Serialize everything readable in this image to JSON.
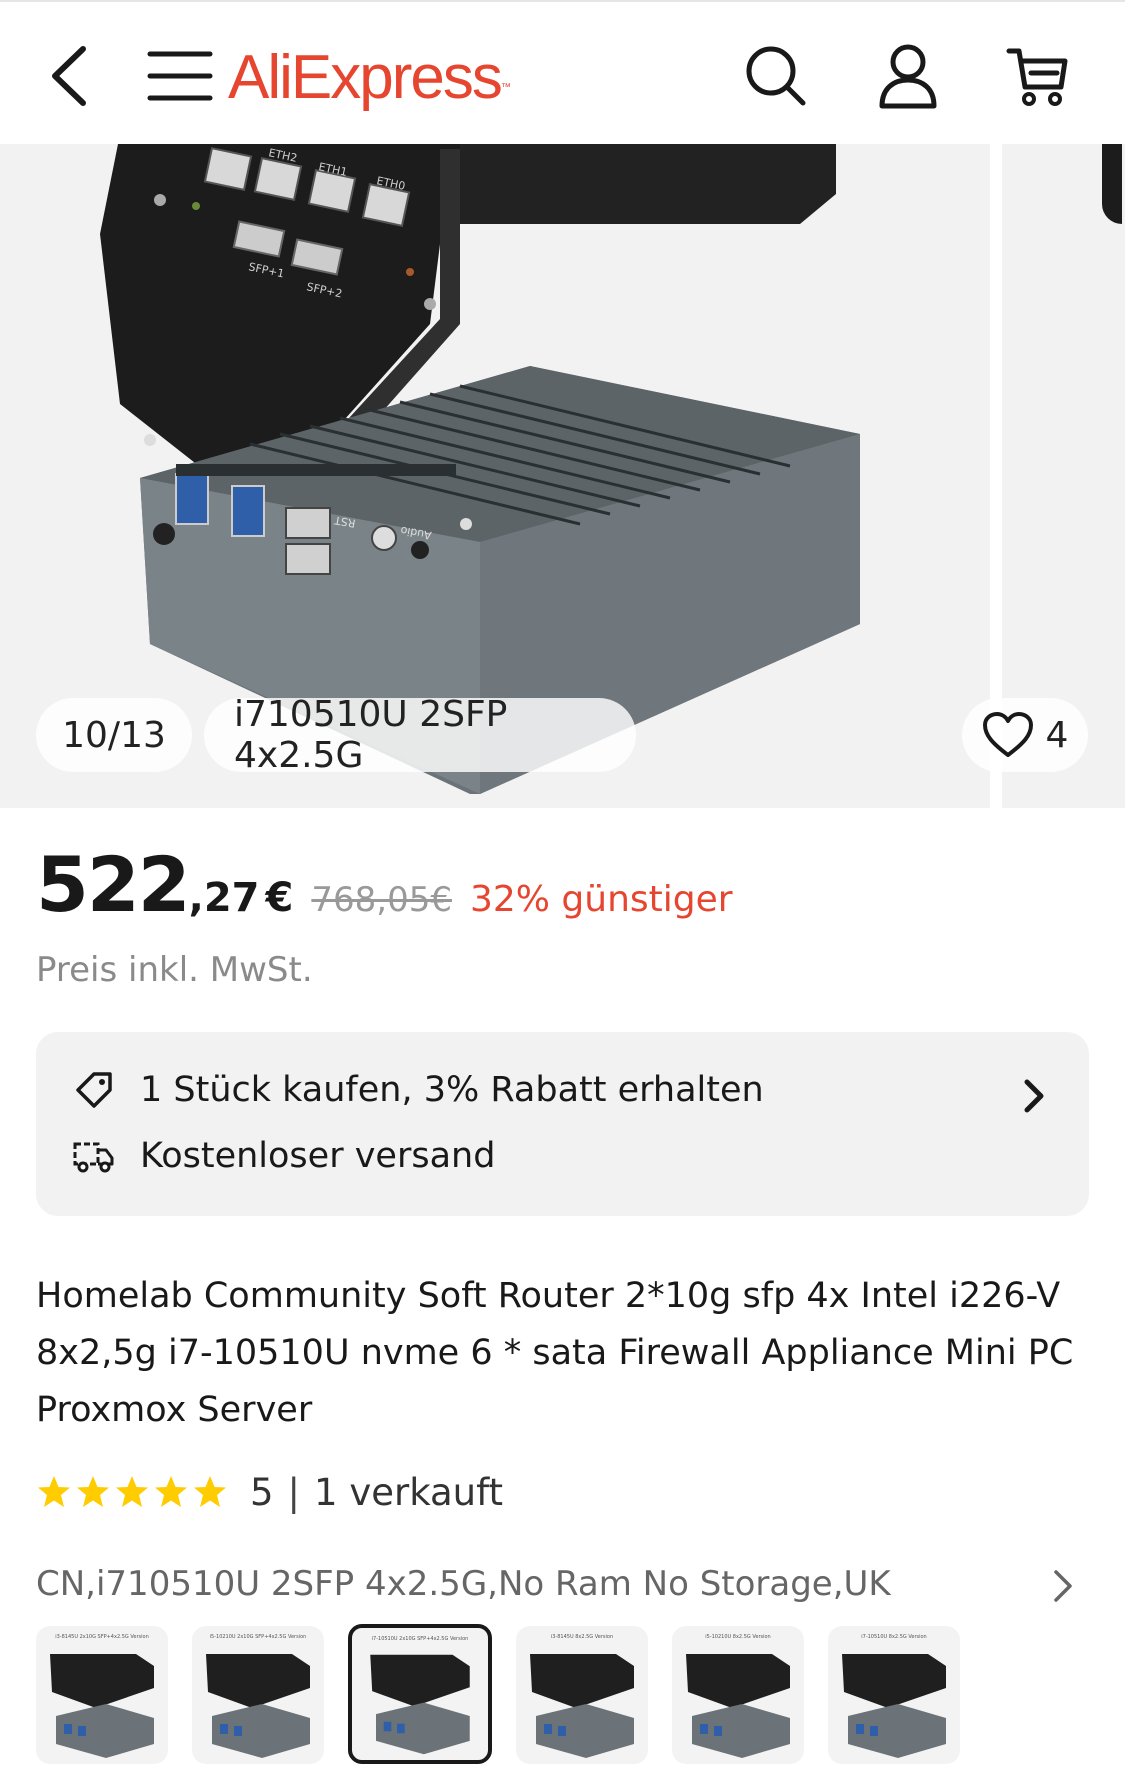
{
  "header": {
    "logo_text": "AliExpress",
    "logo_tm": "™",
    "brand_color": "#e6452f",
    "icons": [
      "back-icon",
      "menu-icon",
      "search-icon",
      "account-icon",
      "cart-icon"
    ]
  },
  "gallery": {
    "counter": "10/13",
    "variant_label": "i710510U 2SFP 4x2.5G",
    "wishlist_count": "4",
    "port_labels": [
      "ETH2",
      "ETH1",
      "ETH0",
      "SFP+1",
      "SFP+2",
      "RST",
      "Audio"
    ]
  },
  "price": {
    "integer": "522",
    "decimal": ",27",
    "currency": "€",
    "original": "768,05€",
    "discount": "32% günstiger",
    "vat_note": "Preis inkl. MwSt."
  },
  "promo": {
    "discount_text": "1 Stück kaufen, 3% Rabatt erhalten",
    "shipping_text": "Kostenloser versand"
  },
  "product": {
    "title": "Homelab Community Soft Router 2*10g sfp 4x Intel i226-V 8x2,5g i7-10510U nvme 6 * sata Firewall Appliance Mini PC Proxmox Server",
    "rating": "5",
    "rating_separator": "|",
    "sold": "1 verkauft",
    "stars": 5
  },
  "sku": {
    "selected_text": "CN,i710510U 2SFP 4x2.5G,No Ram No Storage,UK",
    "thumbnails": [
      {
        "caption": "i3-8145U 2x10G SFP+4x2.5G Version",
        "selected": false
      },
      {
        "caption": "i5-10210U 2x10G SFP+4x2.5G Version",
        "selected": false
      },
      {
        "caption": "i7-10510U 2x10G SFP+4x2.5G Version",
        "selected": true
      },
      {
        "caption": "i3-8145U 8x2.5G Version",
        "selected": false
      },
      {
        "caption": "i5-10210U 8x2.5G Version",
        "selected": false
      },
      {
        "caption": "i7-10510U 8x2.5G Version",
        "selected": false
      }
    ]
  }
}
